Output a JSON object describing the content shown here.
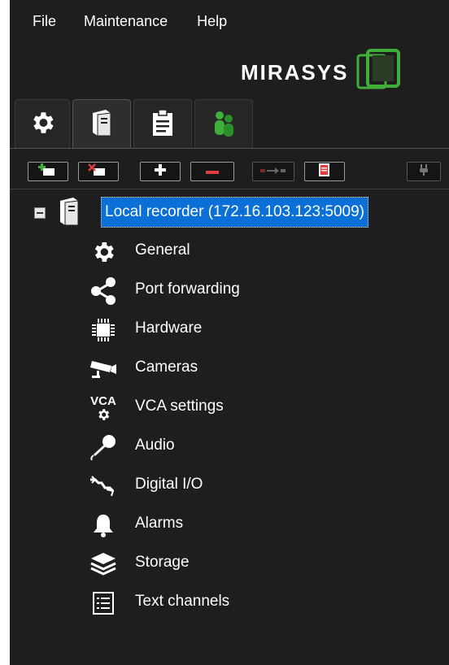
{
  "menu": {
    "file": "File",
    "maintenance": "Maintenance",
    "help": "Help"
  },
  "brand": {
    "name": "MIRASYS"
  },
  "tree": {
    "root_label": "Local recorder (172.16.103.123:5009)",
    "items": [
      {
        "label": "General",
        "icon": "gear-icon"
      },
      {
        "label": "Port forwarding",
        "icon": "share-icon"
      },
      {
        "label": "Hardware",
        "icon": "chip-icon"
      },
      {
        "label": "Cameras",
        "icon": "camera-icon"
      },
      {
        "label": "VCA settings",
        "icon": "vca-icon"
      },
      {
        "label": "Audio",
        "icon": "microphone-icon"
      },
      {
        "label": "Digital I/O",
        "icon": "digital-io-icon"
      },
      {
        "label": "Alarms",
        "icon": "bell-icon"
      },
      {
        "label": "Storage",
        "icon": "layers-icon"
      },
      {
        "label": "Text channels",
        "icon": "list-icon"
      }
    ]
  },
  "icons": {
    "vca_text": "VCA"
  },
  "colors": {
    "selection": "#0a6fd6",
    "accent_green": "#3fae3a",
    "accent_red": "#e23c3c"
  }
}
